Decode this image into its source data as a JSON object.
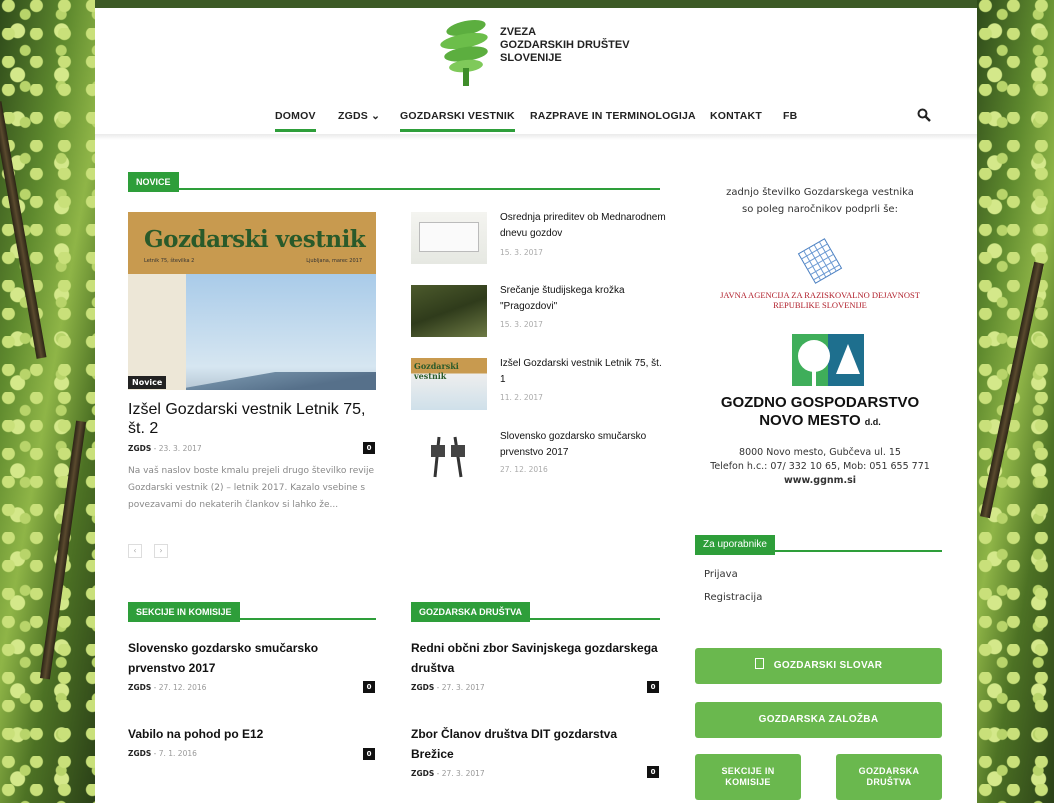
{
  "header": {
    "org_line1": "ZVEZA",
    "org_line2": "GOZDARSKIH DRUŠTEV",
    "org_line3": "SLOVENIJE"
  },
  "nav": {
    "items": [
      {
        "label": "DOMOV",
        "active": true
      },
      {
        "label": "ZGDS ⌄",
        "active": false
      },
      {
        "label": "GOZDARSKI VESTNIK",
        "active": true
      },
      {
        "label": "RAZPRAVE IN TERMINOLOGIJA",
        "active": false
      },
      {
        "label": "KONTAKT",
        "active": false
      },
      {
        "label": "FB",
        "active": false
      }
    ]
  },
  "news": {
    "section_label": "NOVICE",
    "featured": {
      "cover_title": "Gozdarski vestnik",
      "cover_sub_left": "Letnik 75, številka 2",
      "cover_sub_right": "Ljubljana, marec 2017",
      "badge": "Novice",
      "title": "Izšel Gozdarski vestnik Letnik 75, št. 2",
      "author": "ZGDS",
      "date": "- 23. 3. 2017",
      "comments": "0",
      "excerpt": "Na vaš naslov boste kmalu prejeli drugo številko revije Gozdarski vestnik (2) – letnik 2017. Kazalo vsebine s povezavami do nekaterih člankov si lahko že...",
      "prev": "‹",
      "next": "›"
    },
    "items": [
      {
        "title": "Osrednja prireditev ob Mednarodnem dnevu gozdov",
        "date": "15. 3. 2017"
      },
      {
        "title": "Srečanje študijskega krožka \"Pragozdovi\"",
        "date": "15. 3. 2017"
      },
      {
        "title": "Izšel Gozdarski vestnik Letnik 75, št. 1",
        "date": "11. 2. 2017"
      },
      {
        "title": "Slovensko gozdarsko smučarsko prvenstvo 2017",
        "date": "27. 12. 2016"
      }
    ]
  },
  "sekcije": {
    "section_label": "SEKCIJE IN KOMISIJE",
    "posts": [
      {
        "title": "Slovensko gozdarsko smučarsko prvenstvo 2017",
        "author": "ZGDS",
        "date": "- 27. 12. 2016",
        "comments": "0"
      },
      {
        "title": "Vabilo na pohod po E12",
        "author": "ZGDS",
        "date": "- 7. 1. 2016",
        "comments": "0"
      }
    ]
  },
  "drustva": {
    "section_label": "GOZDARSKA DRUŠTVA",
    "posts": [
      {
        "title": "Redni občni zbor Savinjskega gozdarskega društva",
        "author": "ZGDS",
        "date": "- 27. 3. 2017",
        "comments": "0"
      },
      {
        "title": "Zbor Članov društva DIT gozdarstva Brežice",
        "author": "ZGDS",
        "date": "- 27. 3. 2017",
        "comments": "0"
      }
    ]
  },
  "sidebar": {
    "sponsor_line1": "zadnjo številko Gozdarskega vestnika",
    "sponsor_line2": "so poleg naročnikov podprli še:",
    "arrs_line1": "JAVNA AGENCIJA ZA RAZISKOVALNO DEJAVNOST",
    "arrs_line2": "REPUBLIKE SLOVENIJE",
    "ggnm_line1": "GOZDNO GOSPODARSTVO",
    "ggnm_line2": "NOVO MESTO",
    "ggnm_suffix": "d.d.",
    "ggnm_addr1": "8000 Novo mesto, Gubčeva ul. 15",
    "ggnm_addr2": "Telefon h.c.: 07/ 332 10 65, Mob: 051 655 771",
    "ggnm_web": "www.ggnm.si",
    "users_label": "Za uporabnike",
    "login": "Prijava",
    "register": "Registracija",
    "btn_slovar": "GOZDARSKI SLOVAR",
    "btn_zalozba": "GOZDARSKA ZALOŽBA",
    "btn_sekcije_1": "SEKCIJE IN",
    "btn_sekcije_2": "KOMISIJE",
    "btn_drustva_1": "GOZDARSKA",
    "btn_drustva_2": "DRUŠTVA"
  },
  "colors": {
    "accent_green": "#2e9e3a",
    "button_green": "#6ab84e",
    "sponsor_red": "#b01e2a"
  }
}
